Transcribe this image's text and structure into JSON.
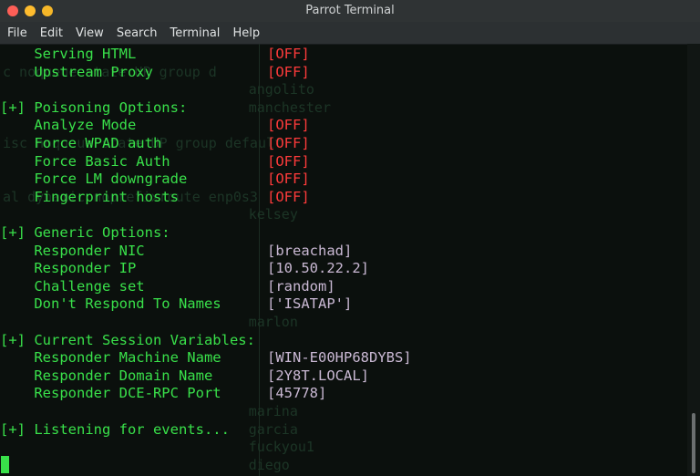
{
  "window": {
    "title": "Parrot Terminal",
    "buttons": [
      "close",
      "minimize",
      "maximize"
    ],
    "button_colors": [
      "#fe5f57",
      "#febc2e",
      "#f5b728"
    ]
  },
  "menu": [
    "File",
    "Edit",
    "View",
    "Search",
    "Terminal",
    "Help"
  ],
  "colors": {
    "prompt_green": "#39e04a",
    "off_red": "#ff3b3b",
    "value_lilac": "#c9b8d3",
    "background": "#0b100d"
  },
  "terminal": {
    "lines": [
      {
        "label": "    Serving HTML",
        "value": "[OFF]",
        "kind": "off"
      },
      {
        "label": "    Upstream Proxy",
        "value": "[OFF]",
        "kind": "off"
      },
      {
        "label": "",
        "value": "",
        "kind": "blank"
      },
      {
        "label": "[+] Poisoning Options:",
        "value": "",
        "kind": "header"
      },
      {
        "label": "    Analyze Mode",
        "value": "[OFF]",
        "kind": "off"
      },
      {
        "label": "    Force WPAD auth",
        "value": "[OFF]",
        "kind": "off"
      },
      {
        "label": "    Force Basic Auth",
        "value": "[OFF]",
        "kind": "off"
      },
      {
        "label": "    Force LM downgrade",
        "value": "[OFF]",
        "kind": "off"
      },
      {
        "label": "    Fingerprint hosts",
        "value": "[OFF]",
        "kind": "off"
      },
      {
        "label": "",
        "value": "",
        "kind": "blank"
      },
      {
        "label": "[+] Generic Options:",
        "value": "",
        "kind": "header"
      },
      {
        "label": "    Responder NIC",
        "value": "[breachad]",
        "kind": "info"
      },
      {
        "label": "    Responder IP",
        "value": "[10.50.22.2]",
        "kind": "info"
      },
      {
        "label": "    Challenge set",
        "value": "[random]",
        "kind": "info"
      },
      {
        "label": "    Don't Respond To Names",
        "value": "['ISATAP']",
        "kind": "info"
      },
      {
        "label": "",
        "value": "",
        "kind": "blank"
      },
      {
        "label": "[+] Current Session Variables:",
        "value": "",
        "kind": "header"
      },
      {
        "label": "    Responder Machine Name",
        "value": "[WIN-E00HP68DYBS]",
        "kind": "info"
      },
      {
        "label": "    Responder Domain Name",
        "value": "[2Y8T.LOCAL]",
        "kind": "info"
      },
      {
        "label": "    Responder DCE-RPC Port",
        "value": "[45778]",
        "kind": "info"
      },
      {
        "label": "",
        "value": "",
        "kind": "blank"
      },
      {
        "label": "[+] Listening for events...",
        "value": "",
        "kind": "header"
      }
    ],
    "background_text": [
      {
        "text": "c noqueue state UP group d",
        "row": 1,
        "col": 0
      },
      {
        "text": "",
        "row": 2,
        "col": 0
      },
      {
        "text": "angolito",
        "row": 2,
        "col": 29
      },
      {
        "text": "manchester",
        "row": 3,
        "col": 29
      },
      {
        "text": "isc noqueue state UP group default",
        "row": 5,
        "col": 0
      },
      {
        "text": "al dynamic noprefixroute enp0s3",
        "row": 8,
        "col": 0
      },
      {
        "text": "kelsey",
        "row": 9,
        "col": 29
      },
      {
        "text": "marlon",
        "row": 15,
        "col": 29
      },
      {
        "text": "marina",
        "row": 20,
        "col": 29
      },
      {
        "text": "garcia",
        "row": 21,
        "col": 29
      },
      {
        "text": "fuckyou1",
        "row": 22,
        "col": 29
      },
      {
        "text": "diego",
        "row": 23,
        "col": 29
      }
    ]
  }
}
